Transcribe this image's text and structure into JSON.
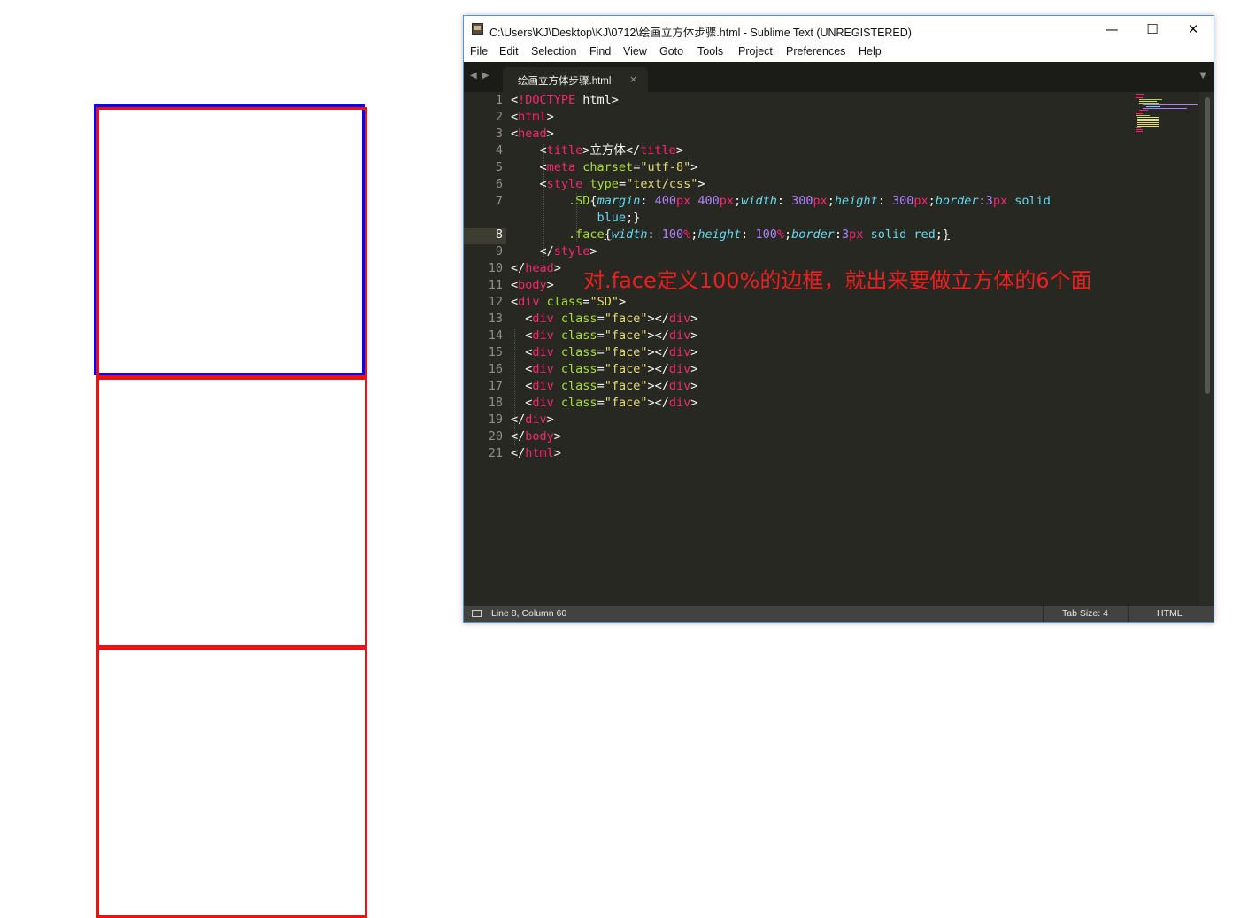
{
  "window": {
    "title": "C:\\Users\\KJ\\Desktop\\KJ\\0712\\绘画立方体步骤.html - Sublime Text (UNREGISTERED)",
    "controls": {
      "minimize": "—",
      "maximize": "☐",
      "close": "✕"
    }
  },
  "menu": [
    "File",
    "Edit",
    "Selection",
    "Find",
    "View",
    "Goto",
    "Tools",
    "Project",
    "Preferences",
    "Help"
  ],
  "tab": {
    "label": "绘画立方体步骤.html",
    "close": "×"
  },
  "editor": {
    "line_numbers": [
      "1",
      "2",
      "3",
      "4",
      "5",
      "6",
      "7",
      "",
      "8",
      "9",
      "10",
      "11",
      "12",
      "13",
      "14",
      "15",
      "16",
      "17",
      "18",
      "19",
      "20",
      "21"
    ],
    "current_line": "8",
    "annotation": "对.face定义100%的边框，就出来要做立方体的6个面"
  },
  "status": {
    "position": "Line 8, Column 60",
    "tab_size": "Tab Size: 4",
    "syntax": "HTML"
  },
  "colors": {
    "accent_border": "#0a00ff",
    "face_border": "#ee1111",
    "annotation": "#ee1f1f"
  }
}
